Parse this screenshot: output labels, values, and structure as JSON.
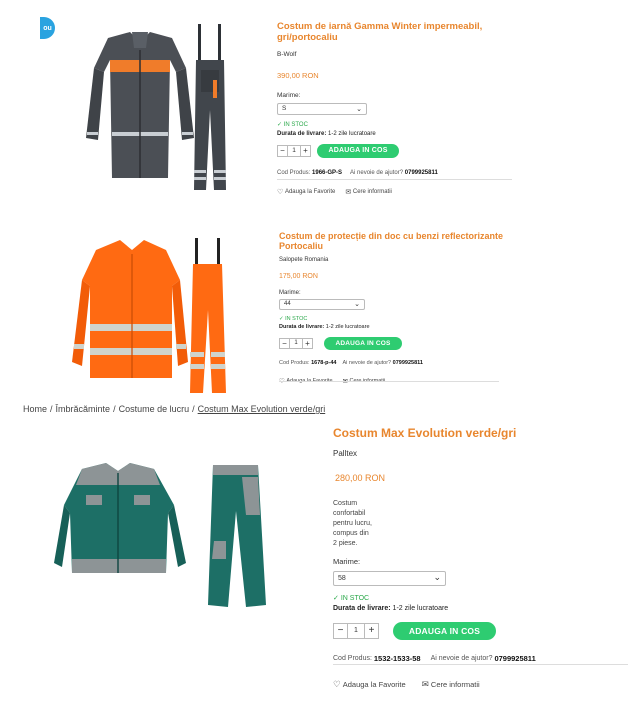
{
  "products": [
    {
      "title": "Costum de iarnă Gamma Winter impermeabil, gri/portocaliu",
      "brand": "B-Wolf",
      "price": "390,00 RON",
      "size_label": "Marime:",
      "size_value": "S",
      "stock": "IN STOC",
      "delivery_label": "Durata de livrare:",
      "delivery_value": "1-2 zile lucratoare",
      "qty": "1",
      "add_label": "ADAUGA IN COS",
      "code_label": "Cod Produs:",
      "code_value": "1966-GP-S",
      "help_label": "Ai nevoie de ajutor?",
      "phone": "0799925811",
      "fav_label": "Adauga la Favorite",
      "info_label": "Cere informatii"
    },
    {
      "title": "Costum de protecție din doc cu benzi reflectorizante Portocaliu",
      "brand": "Salopete Romania",
      "price": "175,00 RON",
      "size_label": "Marime:",
      "size_value": "44",
      "stock": "IN STOC",
      "delivery_label": "Durata de livrare:",
      "delivery_value": "1-2 zile lucratoare",
      "qty": "1",
      "add_label": "ADAUGA IN COS",
      "code_label": "Cod Produs:",
      "code_value": "1678-p-44",
      "help_label": "Ai nevoie de ajutor?",
      "phone": "0799925811",
      "fav_label": "Adauga la Favorite",
      "info_label": "Cere informatii"
    },
    {
      "title": "Costum Max Evolution verde/gri",
      "brand": "Palltex",
      "price": "280,00 RON",
      "description": [
        "Costum",
        "confortabil",
        "pentru lucru,",
        "compus din",
        "2 piese."
      ],
      "size_label": "Marime:",
      "size_value": "58",
      "stock": "IN STOC",
      "delivery_label": "Durata de livrare:",
      "delivery_value": "1-2 zile lucratoare",
      "qty": "1",
      "add_label": "ADAUGA IN COS",
      "code_label": "Cod Produs:",
      "code_value": "1532-1533-58",
      "help_label": "Ai nevoie de ajutor?",
      "phone": "0799925811",
      "fav_label": "Adauga la Favorite",
      "info_label": "Cere informatii"
    }
  ],
  "breadcrumb": {
    "items": [
      "Home",
      "Îmbrăcăminte",
      "Costume de lucru",
      "Costum Max Evolution verde/gri"
    ],
    "separator": "/"
  },
  "badge_text": "ou",
  "colors": {
    "accent": "#e8862e",
    "button": "#2ecc71",
    "stock": "#2aa84a",
    "badge": "#2aa3e0"
  },
  "icons": {
    "check": "check-icon",
    "heart": "heart-icon",
    "mail": "mail-icon",
    "chevron": "chevron-down-icon"
  }
}
